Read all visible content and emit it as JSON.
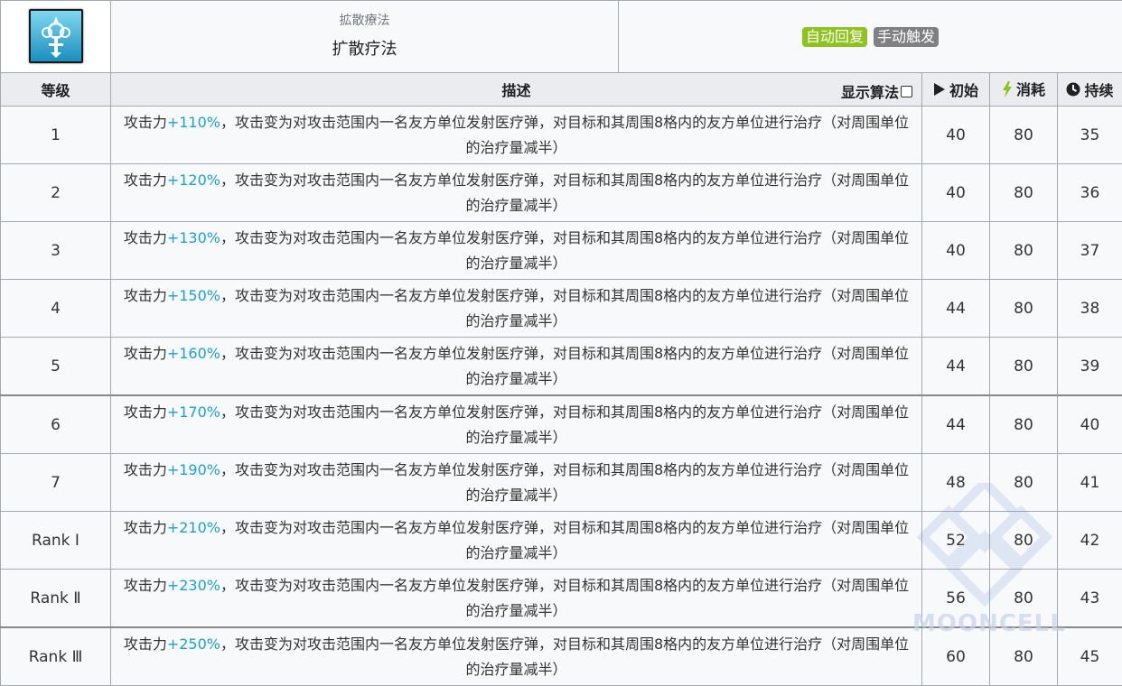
{
  "skill": {
    "icon": "skill-icon-healing-emblem",
    "name_original": "拡散療法",
    "name_cn": "扩散疗法",
    "tags": [
      "自动回复",
      "手动触发"
    ]
  },
  "headers": {
    "level": "等级",
    "description": "描述",
    "show_formula": "显示算法",
    "initial": "初始",
    "cost": "消耗",
    "duration": "持续"
  },
  "desc_parts": {
    "prefix": "攻击力",
    "suffix": "，攻击变为对攻击范围内一名友方单位发射医疗弹，对目标和其周围8格内的友方单位进行治疗（对周围单位的治疗量减半）"
  },
  "rows": [
    {
      "level": "1",
      "atk": "+110%",
      "initial": "40",
      "cost": "80",
      "duration": "35"
    },
    {
      "level": "2",
      "atk": "+120%",
      "initial": "40",
      "cost": "80",
      "duration": "36"
    },
    {
      "level": "3",
      "atk": "+130%",
      "initial": "40",
      "cost": "80",
      "duration": "37"
    },
    {
      "level": "4",
      "atk": "+150%",
      "initial": "44",
      "cost": "80",
      "duration": "38"
    },
    {
      "level": "5",
      "atk": "+160%",
      "initial": "44",
      "cost": "80",
      "duration": "39"
    },
    {
      "level": "6",
      "atk": "+170%",
      "initial": "44",
      "cost": "80",
      "duration": "40"
    },
    {
      "level": "7",
      "atk": "+190%",
      "initial": "48",
      "cost": "80",
      "duration": "41"
    },
    {
      "level": "Rank Ⅰ",
      "atk": "+210%",
      "initial": "52",
      "cost": "80",
      "duration": "42"
    },
    {
      "level": "Rank Ⅱ",
      "atk": "+230%",
      "initial": "56",
      "cost": "80",
      "duration": "43"
    },
    {
      "level": "Rank Ⅲ",
      "atk": "+250%",
      "initial": "60",
      "cost": "80",
      "duration": "45"
    }
  ],
  "watermark": "MOONCELL",
  "colors": {
    "highlight": "#1ba1d1",
    "tag_auto": "#8ec31f",
    "tag_manual": "#808080",
    "cost_icon": "#8ec31f"
  }
}
